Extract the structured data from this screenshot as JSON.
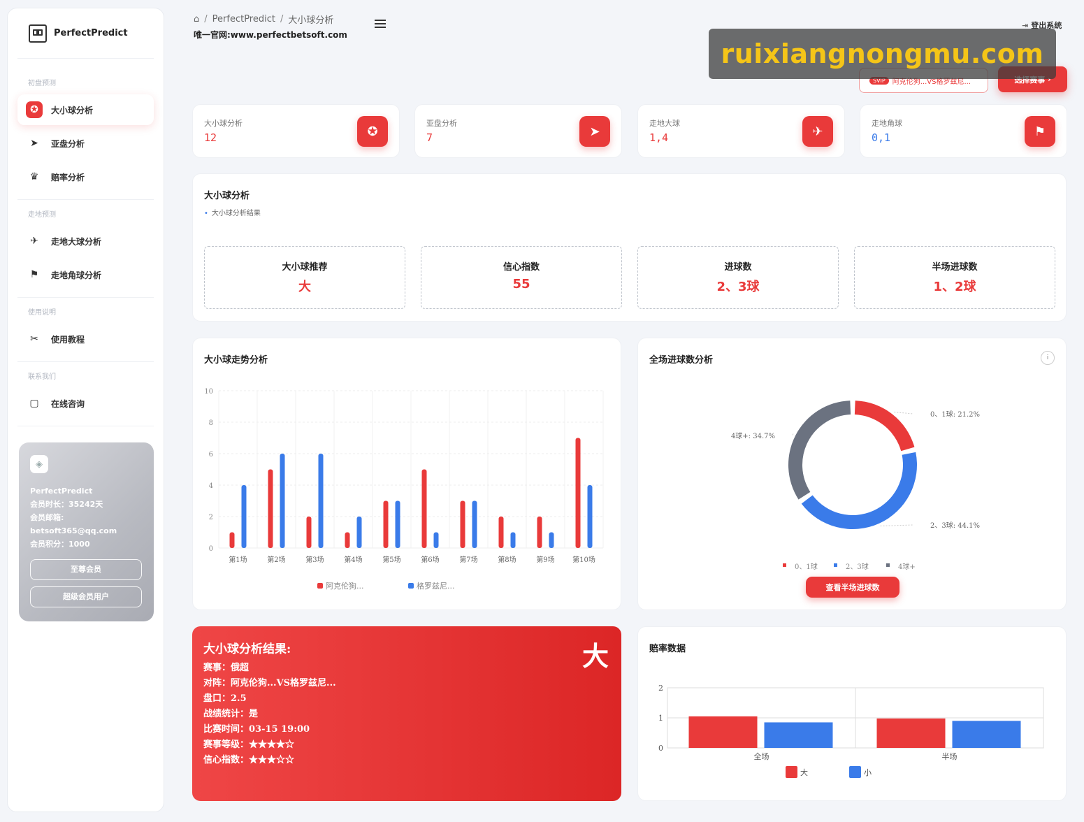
{
  "brand": "PerfectPredict",
  "sidebar": {
    "sections": [
      {
        "head": "初盘预测",
        "items": [
          {
            "label": "大小球分析",
            "icon": "soccer-ball-icon",
            "active": true
          },
          {
            "label": "亚盘分析",
            "icon": "send-icon",
            "active": false
          },
          {
            "label": "赔率分析",
            "icon": "crown-icon",
            "active": false
          }
        ]
      },
      {
        "head": "走地预测",
        "items": [
          {
            "label": "走地大球分析",
            "icon": "rocket-icon",
            "active": false
          },
          {
            "label": "走地角球分析",
            "icon": "flag-icon",
            "active": false
          }
        ]
      },
      {
        "head": "使用说明",
        "items": [
          {
            "label": "使用教程",
            "icon": "tools-icon",
            "active": false
          }
        ]
      },
      {
        "head": "联系我们",
        "items": [
          {
            "label": "在线咨询",
            "icon": "chat-icon",
            "active": false
          }
        ]
      }
    ]
  },
  "member": {
    "name": "PerfectPredict",
    "duration": "会员时长：35242天",
    "email_label": "会员邮箱:",
    "email": "betsoft365@qq.com",
    "points": "会员积分：1000",
    "btn1": "至尊会员",
    "btn2": "超级会员用户"
  },
  "header": {
    "breadcrumb": [
      "PerfectPredict",
      "大小球分析"
    ],
    "site": "唯一官网:www.perfectbetsoft.com",
    "logout": "登出系统",
    "watermark": "ruixiangnongmu.com",
    "svip": "SVIP",
    "match": "阿克伦狗...VS格罗兹尼...",
    "choose": "选择赛事"
  },
  "stats": [
    {
      "title": "大小球分析",
      "value": "12",
      "icon": "soccer-ball-icon",
      "blue": false
    },
    {
      "title": "亚盘分析",
      "value": "7",
      "icon": "send-icon",
      "blue": false
    },
    {
      "title": "走地大球",
      "value": "1,4",
      "icon": "rocket-icon",
      "blue": false
    },
    {
      "title": "走地角球",
      "value": "0,1",
      "icon": "flag-icon",
      "blue": true
    }
  ],
  "analysis": {
    "title": "大小球分析",
    "subtitle": "大小球分析结果",
    "boxes": [
      {
        "label": "大小球推荐",
        "value": "大"
      },
      {
        "label": "信心指数",
        "value": "55"
      },
      {
        "label": "进球数",
        "value": "2、3球"
      },
      {
        "label": "半场进球数",
        "value": "1、2球"
      }
    ]
  },
  "trend": {
    "title": "大小球走势分析",
    "chart_data": {
      "type": "bar",
      "categories": [
        "第1场",
        "第2场",
        "第3场",
        "第4场",
        "第5场",
        "第6场",
        "第7场",
        "第8场",
        "第9场",
        "第10场"
      ],
      "series": [
        {
          "name": "阿克伦狗...",
          "color": "#e93a3a",
          "values": [
            1,
            5,
            2,
            1,
            3,
            5,
            3,
            2,
            2,
            7
          ]
        },
        {
          "name": "格罗兹尼...",
          "color": "#3a7be9",
          "values": [
            4,
            6,
            6,
            2,
            3,
            1,
            3,
            1,
            1,
            4
          ]
        }
      ],
      "yticks": [
        0,
        2,
        4,
        6,
        8,
        10
      ],
      "ylim": [
        0,
        10
      ],
      "grid": true
    }
  },
  "goals": {
    "title": "全场进球数分析",
    "info": "i",
    "button": "查看半场进球数",
    "chart_data": {
      "type": "pie",
      "slices": [
        {
          "name": "0、1球",
          "value": 21.2,
          "color": "#e93a3a",
          "label": "0、1球: 21.2%"
        },
        {
          "name": "2、3球",
          "value": 44.1,
          "color": "#3a7be9",
          "label": "2、3球: 44.1%"
        },
        {
          "name": "4球+",
          "value": 34.7,
          "color": "#6b7280",
          "label": "4球+: 34.7%"
        }
      ],
      "legend": "bottom"
    }
  },
  "result": {
    "title": "大小球分析结果:",
    "big": "大",
    "lines": [
      "赛事：俄超",
      "对阵：阿克伦狗...VS格罗兹尼...",
      "盘口：2.5",
      "战绩统计：是",
      "比赛时间：03-15 19:00",
      "赛事等级：★★★★☆",
      "信心指数：★★★☆☆"
    ]
  },
  "odds": {
    "title": "赔率数据",
    "chart_data": {
      "type": "bar",
      "categories": [
        "全场",
        "半场"
      ],
      "series": [
        {
          "name": "大",
          "color": "#e93a3a",
          "values": [
            1.05,
            0.98
          ]
        },
        {
          "name": "小",
          "color": "#3a7be9",
          "values": [
            0.85,
            0.9
          ]
        }
      ],
      "yticks": [
        0,
        1,
        2
      ],
      "ylim": [
        0,
        2
      ],
      "legend": "bottom"
    }
  }
}
